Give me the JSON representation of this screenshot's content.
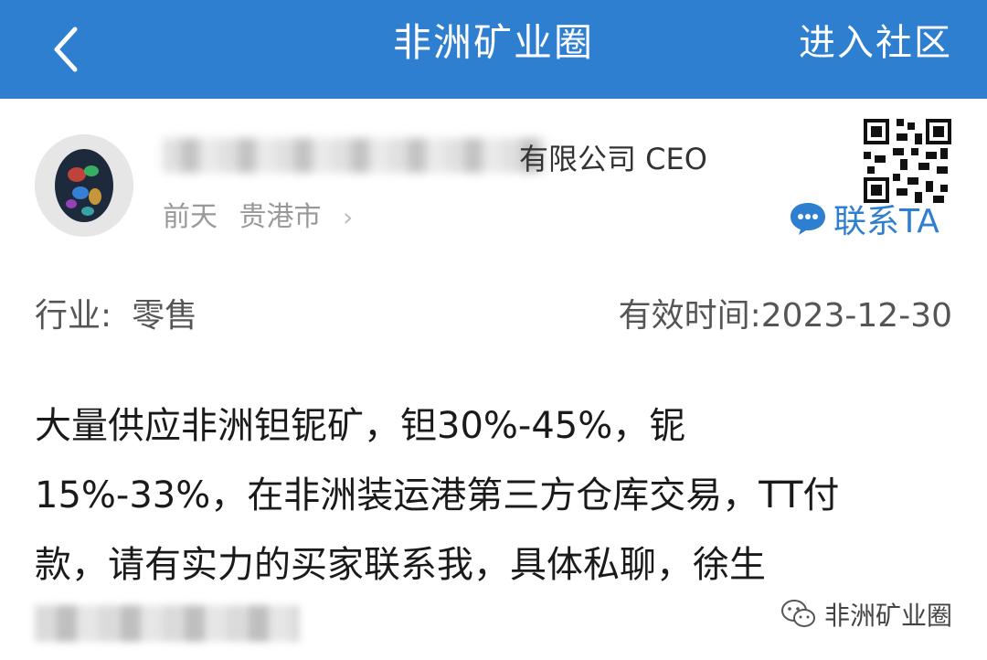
{
  "header": {
    "title": "非洲矿业圈",
    "enter_label": "进入社区",
    "icons": {
      "back": "back-chevron-icon"
    },
    "color": "#2f7fd0"
  },
  "post": {
    "author_company": "有限公司 CEO",
    "time": "前天",
    "location": "贵港市",
    "contact_label": "联系TA",
    "industry_label": "行业:",
    "industry_value": "零售",
    "valid_label": "有效时间:",
    "valid_value": "2023-12-30",
    "description": "大量供应非洲钽铌矿，钽30%-45%，铌\n15%-33%，在非洲装运港第三方仓库交易，TT付\n款，请有实力的买家联系我，具体私聊，徐生",
    "icons": {
      "avatar": "opal-gem-avatar",
      "qr": "qr-code-icon",
      "contact": "chat-bubble-icon",
      "chevron": "chevron-right-icon"
    }
  },
  "watermark": {
    "label": "非洲矿业圈",
    "icon": "wechat-icon"
  }
}
